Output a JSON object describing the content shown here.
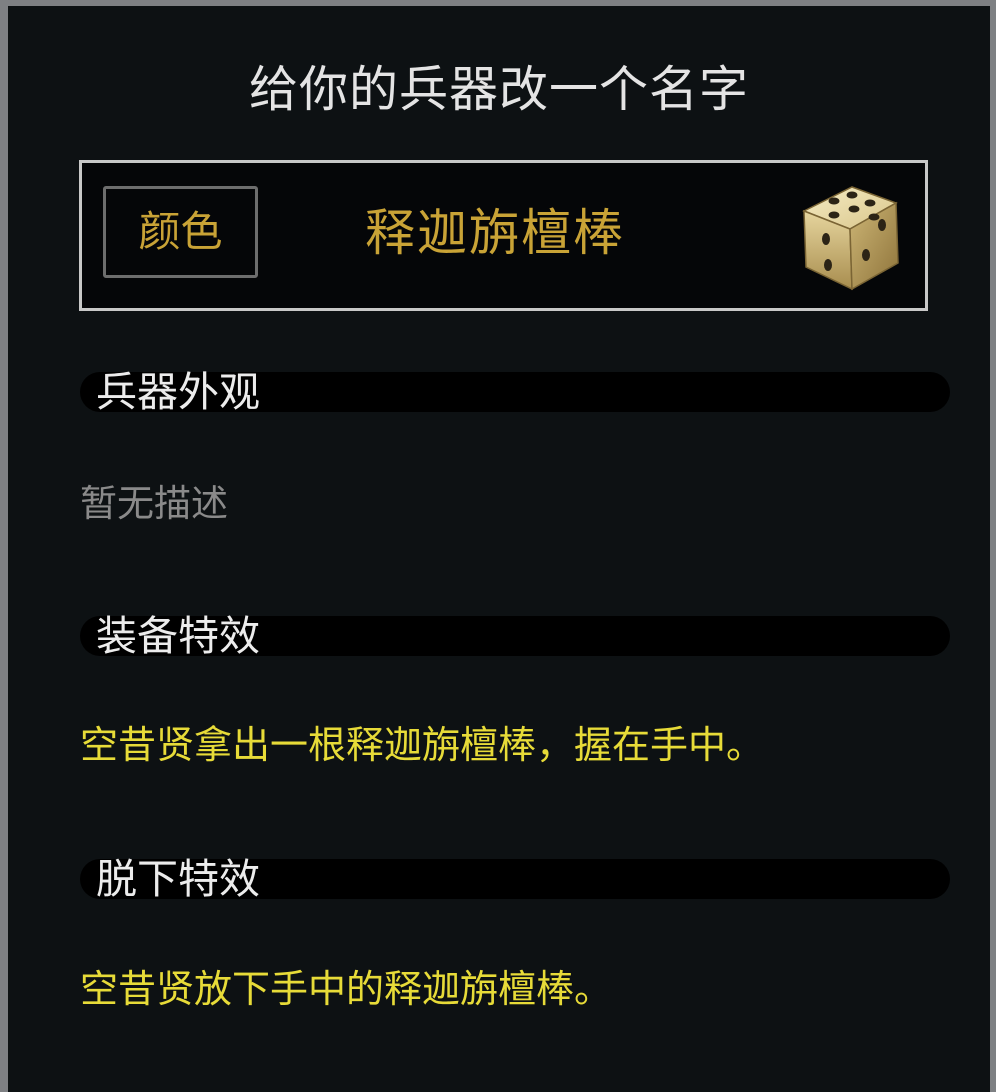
{
  "dialog": {
    "title": "给你的兵器改一个名字"
  },
  "name_editor": {
    "color_button_label": "颜色",
    "weapon_name": "释迦旃檀棒",
    "dice_icon": "dice-icon"
  },
  "sections": {
    "appearance": {
      "title": "兵器外观",
      "text": "暂无描述"
    },
    "equip_effect": {
      "title": "装备特效",
      "text": "空昔贤拿出一根释迦旃檀棒，握在手中。"
    },
    "unequip_effect": {
      "title": "脱下特效",
      "text": "空昔贤放下手中的释迦旃檀棒。"
    }
  },
  "colors": {
    "background": "#0d1113",
    "accent_gold": "#c9a336",
    "effect_yellow": "#e7db38",
    "muted_text": "#8a8a8a"
  }
}
